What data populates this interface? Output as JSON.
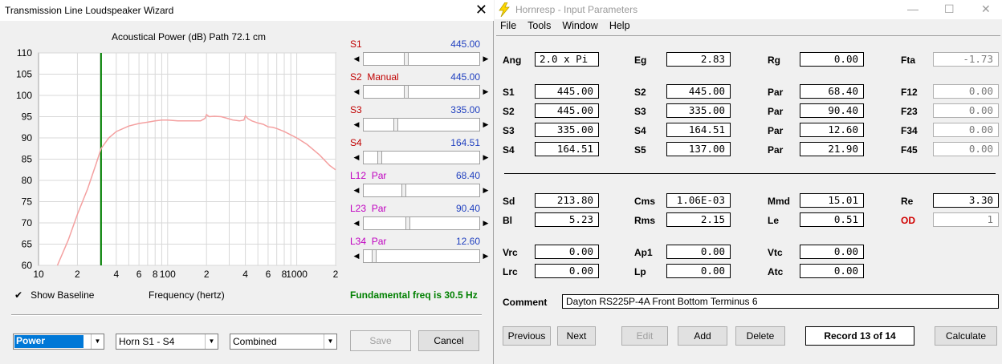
{
  "wizard": {
    "title": "Transmission Line Loudspeaker Wizard",
    "close_glyph": "✕",
    "chart_title": "Acoustical Power (dB)   Path 72.1 cm",
    "xlabel": "Frequency (hertz)",
    "show_baseline_label": "Show Baseline",
    "show_baseline_checked": "✔",
    "fundamental": "Fundamental freq is 30.5 Hz",
    "sliders": [
      {
        "label": "S1",
        "sub": "",
        "value": "445.00",
        "position": 0.42,
        "label_color": "#c00000"
      },
      {
        "label": "S2",
        "sub": "Manual",
        "value": "445.00",
        "position": 0.42,
        "label_color": "#c00000"
      },
      {
        "label": "S3",
        "sub": "",
        "value": "335.00",
        "position": 0.31,
        "label_color": "#c00000"
      },
      {
        "label": "S4",
        "sub": "",
        "value": "164.51",
        "position": 0.14,
        "label_color": "#c00000"
      },
      {
        "label": "L12",
        "sub": "Par",
        "value": "68.40",
        "position": 0.39,
        "label_color": "#c000c0"
      },
      {
        "label": "L23",
        "sub": "Par",
        "value": "90.40",
        "position": 0.43,
        "label_color": "#c000c0"
      },
      {
        "label": "L34",
        "sub": "Par",
        "value": "12.60",
        "position": 0.08,
        "label_color": "#c000c0"
      }
    ],
    "combos": [
      "Power",
      "Horn S1 - S4",
      "Combined"
    ],
    "save_label": "Save",
    "cancel_label": "Cancel"
  },
  "chart_data": {
    "type": "line",
    "title": "Acoustical Power (dB)   Path 72.1 cm",
    "xlabel": "Frequency (hertz)",
    "ylabel": "",
    "xscale": "log",
    "xlim": [
      10,
      2000
    ],
    "ylim": [
      60,
      110
    ],
    "yticks": [
      60,
      65,
      70,
      75,
      80,
      85,
      90,
      95,
      100,
      105,
      110
    ],
    "xtick_labels": [
      "10",
      "2",
      "4",
      "6",
      "8",
      "100",
      "2",
      "4",
      "6",
      "8",
      "1000",
      "2"
    ],
    "grid": true,
    "marker_x": 30.5,
    "marker_color": "#008000",
    "series": [
      {
        "color": "#f4a0a0",
        "points": [
          [
            14,
            60
          ],
          [
            17,
            66
          ],
          [
            20,
            72
          ],
          [
            24,
            78
          ],
          [
            28,
            84
          ],
          [
            30.5,
            87.5
          ],
          [
            35,
            90
          ],
          [
            40,
            91.5
          ],
          [
            50,
            92.8
          ],
          [
            60,
            93.4
          ],
          [
            70,
            93.7
          ],
          [
            80,
            94
          ],
          [
            90,
            94.2
          ],
          [
            100,
            94.2
          ],
          [
            120,
            94
          ],
          [
            150,
            94
          ],
          [
            180,
            94
          ],
          [
            195,
            94.6
          ],
          [
            200,
            95.5
          ],
          [
            210,
            95
          ],
          [
            230,
            95.1
          ],
          [
            260,
            95
          ],
          [
            290,
            94.6
          ],
          [
            320,
            94.2
          ],
          [
            360,
            94
          ],
          [
            390,
            94.2
          ],
          [
            400,
            95.2
          ],
          [
            420,
            94.5
          ],
          [
            450,
            94
          ],
          [
            500,
            93.5
          ],
          [
            550,
            93.2
          ],
          [
            600,
            92.6
          ],
          [
            650,
            92.5
          ],
          [
            700,
            92.2
          ],
          [
            800,
            91.5
          ],
          [
            1000,
            90
          ],
          [
            1200,
            88.5
          ],
          [
            1500,
            86
          ],
          [
            1800,
            83.5
          ],
          [
            2000,
            82.5
          ]
        ]
      }
    ]
  },
  "hornresp": {
    "title": "Hornresp - Input Parameters",
    "menu": [
      "File",
      "Tools",
      "Window",
      "Help"
    ],
    "window_controls": [
      "—",
      "☐",
      "✕"
    ],
    "rows": [
      {
        "l1": "Ang",
        "v1": "2.0 x Pi",
        "l2": "Eg",
        "v2": "2.83",
        "l3": "Rg",
        "v3": "0.00",
        "l4": "Fta",
        "v4": "-1.73"
      },
      {
        "l1": "S1",
        "v1": "445.00",
        "l2": "S2",
        "v2": "445.00",
        "l3": "Par",
        "v3": "68.40",
        "l4": "F12",
        "v4": "0.00"
      },
      {
        "l1": "S2",
        "v1": "445.00",
        "l2": "S3",
        "v2": "335.00",
        "l3": "Par",
        "v3": "90.40",
        "l4": "F23",
        "v4": "0.00"
      },
      {
        "l1": "S3",
        "v1": "335.00",
        "l2": "S4",
        "v2": "164.51",
        "l3": "Par",
        "v3": "12.60",
        "l4": "F34",
        "v4": "0.00"
      },
      {
        "l1": "S4",
        "v1": "164.51",
        "l2": "S5",
        "v2": "137.00",
        "l3": "Par",
        "v3": "21.90",
        "l4": "F45",
        "v4": "0.00"
      },
      {
        "l1": "Sd",
        "v1": "213.80",
        "l2": "Cms",
        "v2": "1.06E-03",
        "l3": "Mmd",
        "v3": "15.01",
        "l4": "Re",
        "v4": "3.30"
      },
      {
        "l1": "Bl",
        "v1": "5.23",
        "l2": "Rms",
        "v2": "2.15",
        "l3": "Le",
        "v3": "0.51",
        "l4": "OD",
        "v4": "1"
      },
      {
        "l1": "Vrc",
        "v1": "0.00",
        "l2": "Ap1",
        "v2": "0.00",
        "l3": "Vtc",
        "v3": "0.00",
        "l4": "",
        "v4": ""
      },
      {
        "l1": "Lrc",
        "v1": "0.00",
        "l2": "Lp",
        "v2": "0.00",
        "l3": "Atc",
        "v3": "0.00",
        "l4": "",
        "v4": ""
      }
    ],
    "comment_label": "Comment",
    "comment_value": "Dayton RS225P-4A Front Bottom Terminus 6",
    "buttons": {
      "previous": "Previous",
      "next": "Next",
      "edit": "Edit",
      "add": "Add",
      "delete": "Delete",
      "calculate": "Calculate"
    },
    "record": "Record 13 of 14"
  }
}
